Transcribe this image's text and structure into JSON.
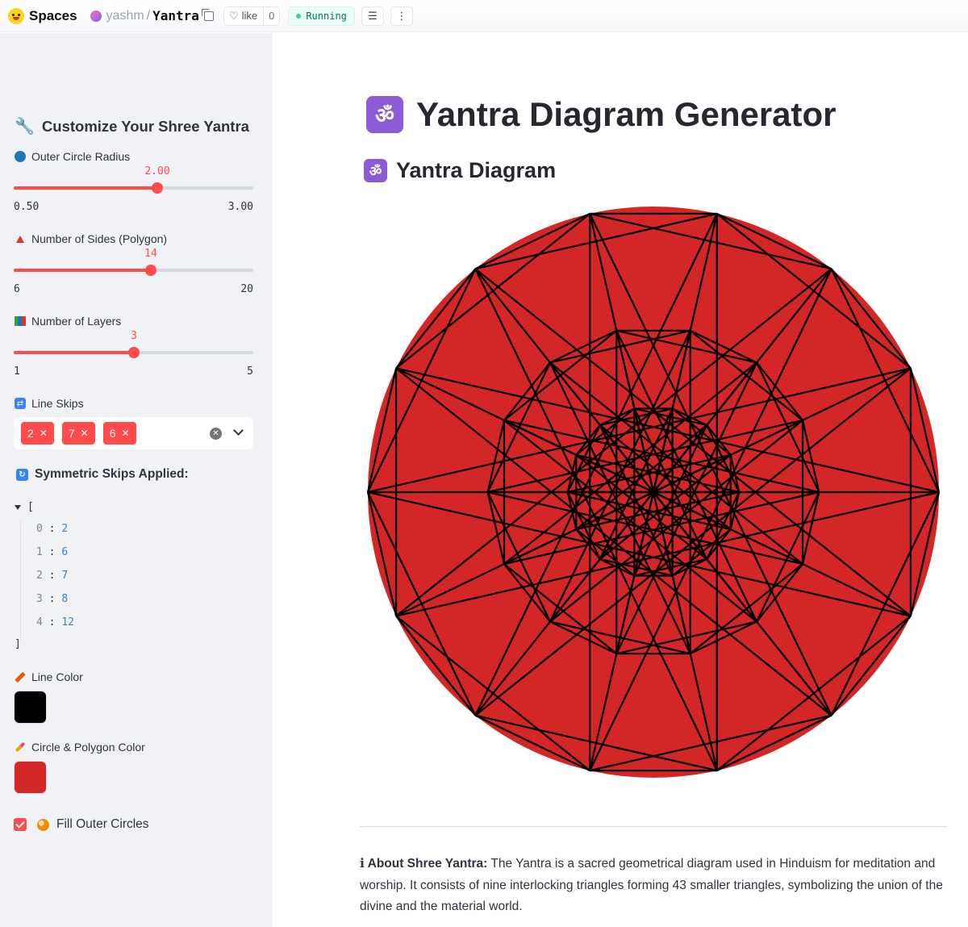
{
  "topbar": {
    "spaces_label": "Spaces",
    "user": "yashm",
    "repo": "Yantra",
    "like_label": "like",
    "like_count": "0",
    "status": "Running"
  },
  "sidebar": {
    "title": "Customize Your Shree Yantra",
    "radius": {
      "label": "Outer Circle Radius",
      "value": "2.00",
      "min": "0.50",
      "max": "3.00",
      "fraction": 0.6
    },
    "sides": {
      "label": "Number of Sides (Polygon)",
      "value": "14",
      "min": "6",
      "max": "20",
      "fraction": 0.5714
    },
    "layers": {
      "label": "Number of Layers",
      "value": "3",
      "min": "1",
      "max": "5",
      "fraction": 0.5
    },
    "skips": {
      "label": "Line Skips",
      "chips": [
        "2",
        "7",
        "6"
      ]
    },
    "symmetric": {
      "title": "Symmetric Skips Applied:",
      "open": "[",
      "close": "]",
      "items": [
        {
          "k": "0",
          "v": "2"
        },
        {
          "k": "1",
          "v": "6"
        },
        {
          "k": "2",
          "v": "7"
        },
        {
          "k": "3",
          "v": "8"
        },
        {
          "k": "4",
          "v": "12"
        }
      ]
    },
    "line_color": {
      "label": "Line Color",
      "value": "#000000"
    },
    "fill_color": {
      "label": "Circle & Polygon Color",
      "value": "#d32727"
    },
    "fill_checkbox": {
      "label": "Fill Outer Circles",
      "checked": true
    }
  },
  "main": {
    "title": "Yantra Diagram Generator",
    "subtitle": "Yantra Diagram",
    "om": "ॐ",
    "about_label": "ℹ About Shree Yantra:",
    "about_text": " The Yantra is a sacred geometrical diagram used in Hinduism for meditation and worship. It consists of nine interlocking triangles forming 43 smaller triangles, symbolizing the union of the divine and the material world."
  },
  "yantra": {
    "sides": 14,
    "layers": 3,
    "skips": [
      2,
      6,
      7
    ],
    "line_color": "#000000",
    "fill_color": "#d32727"
  }
}
